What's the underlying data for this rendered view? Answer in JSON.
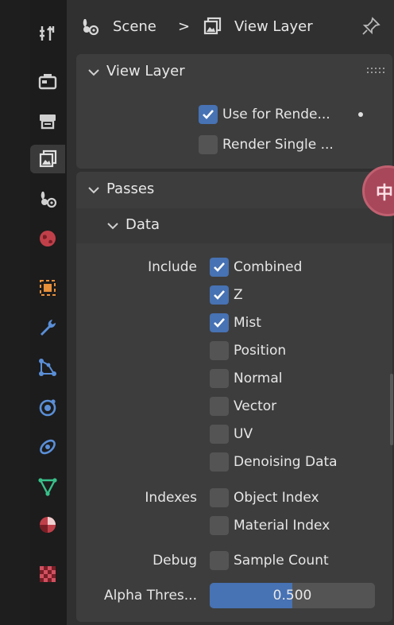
{
  "header": {
    "breadcrumb_scene": "Scene",
    "breadcrumb_sep": ">",
    "breadcrumb_layer": "View Layer"
  },
  "tabs": [
    {
      "name": "tool",
      "icon": "tool-icon"
    },
    {
      "name": "render",
      "icon": "render-icon"
    },
    {
      "name": "output",
      "icon": "output-icon"
    },
    {
      "name": "view-layer",
      "icon": "view-layer-icon",
      "active": true
    },
    {
      "name": "scene",
      "icon": "scene-icon"
    },
    {
      "name": "world",
      "icon": "world-icon"
    },
    {
      "name": "object",
      "icon": "object-icon"
    },
    {
      "name": "modifiers",
      "icon": "wrench-icon"
    },
    {
      "name": "particles",
      "icon": "particles-icon"
    },
    {
      "name": "physics",
      "icon": "physics-icon"
    },
    {
      "name": "constraints",
      "icon": "constraints-icon"
    },
    {
      "name": "data",
      "icon": "mesh-data-icon"
    },
    {
      "name": "material",
      "icon": "material-icon"
    },
    {
      "name": "texture",
      "icon": "texture-icon"
    }
  ],
  "view_layer_panel": {
    "title": "View Layer",
    "use_for_render": {
      "label": "Use for Rende...",
      "checked": true
    },
    "render_single": {
      "label": "Render Single ...",
      "checked": false
    }
  },
  "passes_panel": {
    "title": "Passes",
    "data_title": "Data",
    "include_label": "Include",
    "include": [
      {
        "label": "Combined",
        "checked": true
      },
      {
        "label": "Z",
        "checked": true
      },
      {
        "label": "Mist",
        "checked": true
      },
      {
        "label": "Position",
        "checked": false
      },
      {
        "label": "Normal",
        "checked": false
      },
      {
        "label": "Vector",
        "checked": false
      },
      {
        "label": "UV",
        "checked": false
      },
      {
        "label": "Denoising Data",
        "checked": false
      }
    ],
    "indexes_label": "Indexes",
    "indexes": [
      {
        "label": "Object Index",
        "checked": false
      },
      {
        "label": "Material Index",
        "checked": false
      }
    ],
    "debug_label": "Debug",
    "debug": [
      {
        "label": "Sample Count",
        "checked": false
      }
    ],
    "alpha_label": "Alpha Thres...",
    "alpha_value": "0.500",
    "alpha_fraction": 0.5
  },
  "overlay": {
    "badge_text": "中"
  },
  "colors": {
    "accent": "#4772b3",
    "panel": "#3d3d3d",
    "background": "#303030"
  }
}
